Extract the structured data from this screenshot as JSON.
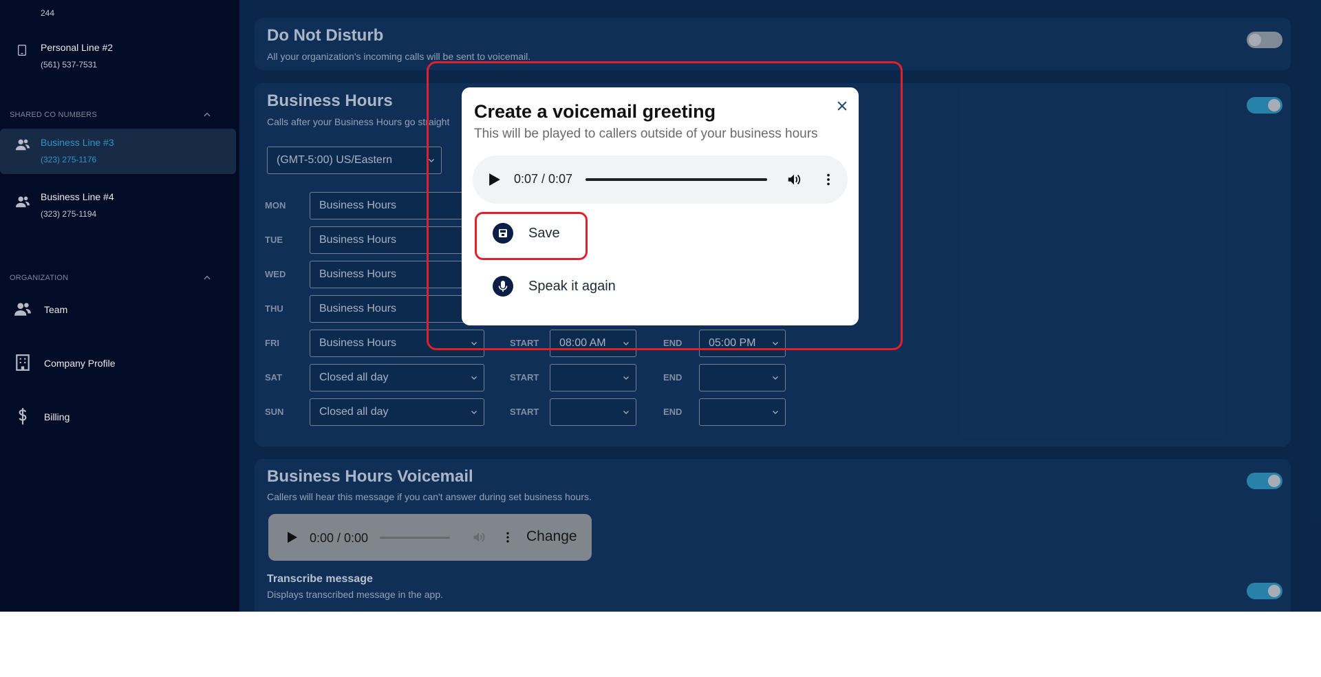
{
  "sidebar": {
    "top_item_number": "244",
    "personal_line": {
      "label": "Personal Line #2",
      "number": "(561) 537-7531"
    },
    "shared_section": "SHARED CO NUMBERS",
    "shared_lines": [
      {
        "label": "Business Line #3",
        "number": "(323) 275-1176",
        "active": true
      },
      {
        "label": "Business Line #4",
        "number": "(323) 275-1194",
        "active": false
      }
    ],
    "org_section": "ORGANIZATION",
    "org_items": [
      {
        "label": "Team",
        "icon": "team-icon"
      },
      {
        "label": "Company Profile",
        "icon": "building-icon"
      },
      {
        "label": "Billing",
        "icon": "dollar-icon"
      }
    ]
  },
  "dnd": {
    "title": "Do Not Disturb",
    "desc": "All your organization's incoming calls will be sent to voicemail.",
    "enabled": false
  },
  "business_hours": {
    "title": "Business Hours",
    "desc": "Calls after your Business Hours go straight",
    "timezone": "(GMT-5:00) US/Eastern",
    "enabled": true,
    "start_label": "START",
    "end_label": "END",
    "days": [
      {
        "day": "MON",
        "mode": "Business Hours"
      },
      {
        "day": "TUE",
        "mode": "Business Hours"
      },
      {
        "day": "WED",
        "mode": "Business Hours"
      },
      {
        "day": "THU",
        "mode": "Business Hours"
      },
      {
        "day": "FRI",
        "mode": "Business Hours",
        "start": "08:00 AM",
        "end": "05:00 PM"
      },
      {
        "day": "SAT",
        "mode": "Closed all day",
        "start": "",
        "end": ""
      },
      {
        "day": "SUN",
        "mode": "Closed all day",
        "start": "",
        "end": ""
      }
    ]
  },
  "voicemail": {
    "title": "Business Hours Voicemail",
    "desc": "Callers will hear this message if you can't answer during set business hours.",
    "enabled": true,
    "player_time": "0:00 / 0:00",
    "change_label": "Change",
    "transcribe_title": "Transcribe message",
    "transcribe_desc": "Displays transcribed message in the app.",
    "transcribe_enabled": true
  },
  "modal": {
    "title": "Create a voicemail greeting",
    "subtitle": "This will be played to callers outside of your business hours",
    "player_time": "0:07 / 0:07",
    "progress": 1.0,
    "save_label": "Save",
    "speak_again_label": "Speak it again"
  },
  "colors": {
    "sidebar_bg": "#040e2a",
    "content_bg": "#0b2a52",
    "card_bg": "#12345e",
    "accent": "#2b8db8",
    "active_link": "#3aa0d6",
    "highlight": "#e0202a"
  }
}
